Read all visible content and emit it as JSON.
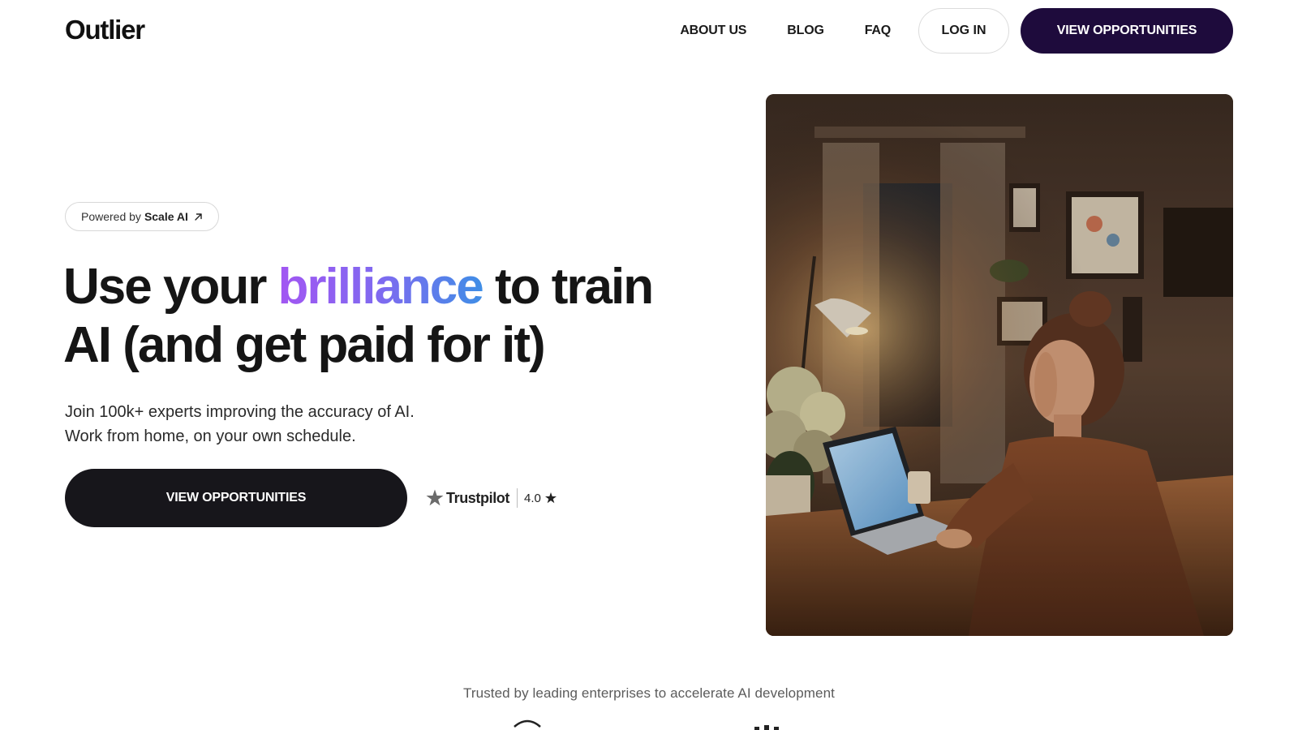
{
  "header": {
    "logo": "Outlier",
    "nav": [
      {
        "label": "ABOUT US"
      },
      {
        "label": "BLOG"
      },
      {
        "label": "FAQ"
      }
    ],
    "login_label": "LOG IN",
    "cta_label": "VIEW OPPORTUNITIES"
  },
  "hero": {
    "powered_by": {
      "prefix": "Powered by",
      "brand": "Scale AI",
      "icon": "arrow-up-right-icon"
    },
    "headline": {
      "before": "Use your ",
      "accent": "brilliance",
      "after_line1": " to train",
      "line2": "AI (and get paid for it)"
    },
    "subtext": "Join 100k+ experts improving the accuracy of AI. Work from home, on your own schedule.",
    "cta_label": "VIEW OPPORTUNITIES",
    "trustpilot": {
      "name": "Trustpilot",
      "rating": "4.0",
      "icon": "star-icon"
    },
    "image_icon": "hero-photo"
  },
  "trusted": {
    "text": "Trusted by leading enterprises to accelerate AI development"
  },
  "colors": {
    "header_cta_bg": "#1e0b3c",
    "hero_cta_bg": "#17161b",
    "accent_gradient_start": "#a256f2",
    "accent_gradient_end": "#3f8ee6"
  }
}
